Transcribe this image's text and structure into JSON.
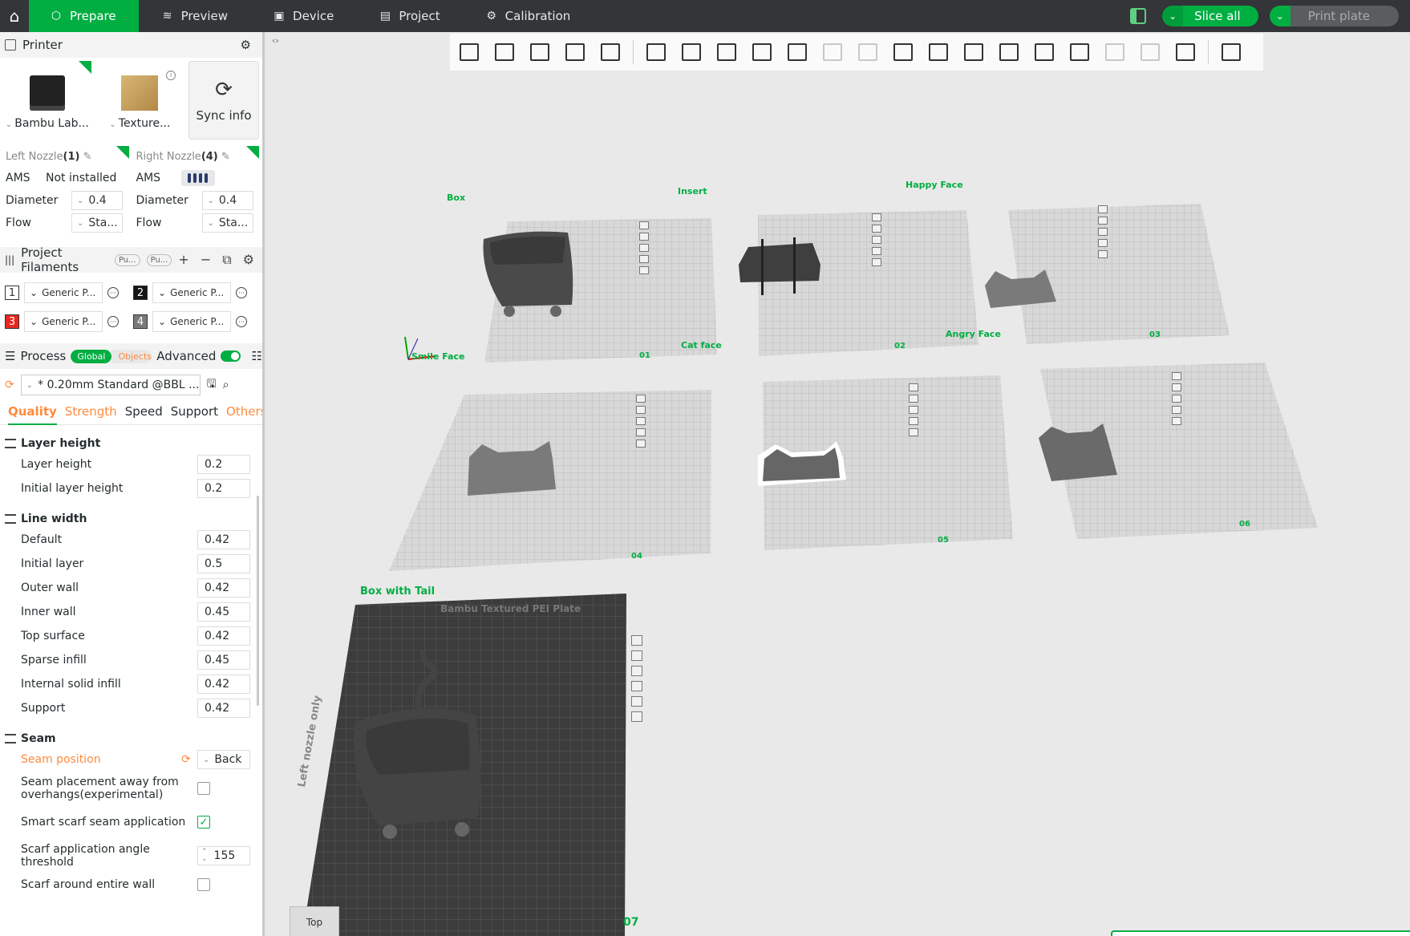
{
  "topbar": {
    "tabs": [
      {
        "label": "Prepare",
        "icon": "cube-icon"
      },
      {
        "label": "Preview",
        "icon": "layers-icon"
      },
      {
        "label": "Device",
        "icon": "device-icon"
      },
      {
        "label": "Project",
        "icon": "project-icon"
      },
      {
        "label": "Calibration",
        "icon": "calibration-icon"
      }
    ],
    "slice_all": "Slice all",
    "print_plate": "Print plate",
    "accent": "#00ae42"
  },
  "printer": {
    "title": "Printer",
    "printer_label": "Bambu Lab...",
    "plate_label": "Texture...",
    "sync_label": "Sync info",
    "left_nozzle": {
      "title": "Left Nozzle",
      "count": "(1)",
      "ams_label": "AMS",
      "ams_value": "Not installed",
      "diameter_label": "Diameter",
      "diameter": "0.4",
      "flow_label": "Flow",
      "flow": "Sta..."
    },
    "right_nozzle": {
      "title": "Right Nozzle",
      "count": "(4)",
      "ams_label": "AMS",
      "diameter_label": "Diameter",
      "diameter": "0.4",
      "flow_label": "Flow",
      "flow": "Sta..."
    }
  },
  "filaments": {
    "title": "Project Filaments",
    "pill1": "Pu...",
    "pill2": "Pu...",
    "items": [
      {
        "num": "1",
        "label": "Generic P...",
        "color": "#ffffff",
        "text": "#333333"
      },
      {
        "num": "2",
        "label": "Generic P...",
        "color": "#161616",
        "text": "#ffffff"
      },
      {
        "num": "3",
        "label": "Generic P...",
        "color": "#e8271f",
        "text": "#ffffff"
      },
      {
        "num": "4",
        "label": "Generic P...",
        "color": "#7a7a7a",
        "text": "#ffffff"
      }
    ]
  },
  "process": {
    "title": "Process",
    "global": "Global",
    "objects": "Objects",
    "advanced": "Advanced",
    "preset": "* 0.20mm Standard @BBL ...",
    "tabs": [
      "Quality",
      "Strength",
      "Speed",
      "Support",
      "Others"
    ],
    "groups": [
      {
        "title": "Layer height",
        "rows": [
          {
            "label": "Layer height",
            "value": "0.2"
          },
          {
            "label": "Initial layer height",
            "value": "0.2"
          }
        ]
      },
      {
        "title": "Line width",
        "rows": [
          {
            "label": "Default",
            "value": "0.42"
          },
          {
            "label": "Initial layer",
            "value": "0.5"
          },
          {
            "label": "Outer wall",
            "value": "0.42"
          },
          {
            "label": "Inner wall",
            "value": "0.45"
          },
          {
            "label": "Top surface",
            "value": "0.42"
          },
          {
            "label": "Sparse infill",
            "value": "0.45"
          },
          {
            "label": "Internal solid infill",
            "value": "0.42"
          },
          {
            "label": "Support",
            "value": "0.42"
          }
        ]
      }
    ],
    "seam": {
      "title": "Seam",
      "position_label": "Seam position",
      "position_value": "Back",
      "away_label": "Seam placement away from overhangs(experimental)",
      "away_checked": false,
      "smart_label": "Smart scarf seam application",
      "smart_checked": true,
      "angle_label": "Scarf application angle threshold",
      "angle_value": "155",
      "entire_label": "Scarf around entire wall"
    }
  },
  "canvas": {
    "plates": [
      {
        "name": "Box",
        "num": "01"
      },
      {
        "name": "Insert",
        "num": "02"
      },
      {
        "name": "Happy Face",
        "num": "03"
      },
      {
        "name": "Smile Face",
        "num": "04"
      },
      {
        "name": "Cat face",
        "num": "05"
      },
      {
        "name": "Angry Face",
        "num": "06"
      },
      {
        "name": "Box with Tail",
        "num": "07"
      }
    ],
    "plate_brand": "Bambu Textured PEI Plate",
    "plate_side": "Left nozzle only",
    "view_label": "Top"
  }
}
